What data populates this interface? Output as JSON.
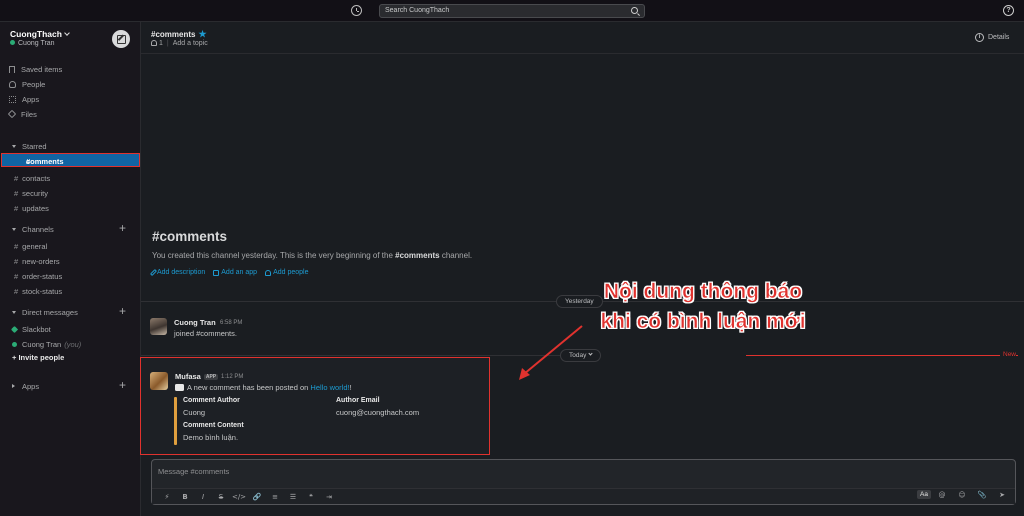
{
  "topbar": {
    "search_placeholder": "Search CuongThach",
    "help": "?"
  },
  "sidebar": {
    "workspace": "CuongThach",
    "user": "Cuong Tran",
    "nav": [
      {
        "label": "Saved items",
        "icon": "bookmark-icon"
      },
      {
        "label": "People",
        "icon": "people-icon"
      },
      {
        "label": "Apps",
        "icon": "apps-icon"
      },
      {
        "label": "Files",
        "icon": "files-icon"
      }
    ],
    "starred": {
      "title": "Starred",
      "active": "comments",
      "items": [
        "contacts",
        "security",
        "updates"
      ]
    },
    "channels": {
      "title": "Channels",
      "items": [
        "general",
        "new-orders",
        "order-status",
        "stock-status"
      ]
    },
    "dms": {
      "title": "Direct messages",
      "items": [
        {
          "name": "Slackbot",
          "suffix": ""
        },
        {
          "name": "Cuong Tran",
          "suffix": "(you)"
        }
      ],
      "invite": "Invite people"
    },
    "apps_title": "Apps",
    "hash": "#"
  },
  "channel": {
    "name": "#comments",
    "members": "1",
    "add_topic": "Add a topic",
    "details": "Details",
    "intro_title": "#comments",
    "intro_text_pre": "You created this channel yesterday. This is the very beginning of the ",
    "intro_text_channel": "#comments",
    "intro_text_post": " channel.",
    "links": [
      "Add description",
      "Add an app",
      "Add people"
    ]
  },
  "dividers": {
    "yesterday": "Yesterday",
    "today": "Today",
    "new": "New"
  },
  "messages": {
    "join": {
      "author": "Cuong Tran",
      "time": "6:58 PM",
      "text": "joined #comments."
    },
    "bot": {
      "author": "Mufasa",
      "badge": "APP",
      "time": "1:12 PM",
      "text_pre": "A new comment has been posted on ",
      "link": "Hello world!",
      "text_post": "!",
      "fields": {
        "author_label": "Comment Author",
        "author_value": "Cuong",
        "email_label": "Author Email",
        "email_value": "cuong@cuongthach.com",
        "content_label": "Comment Content",
        "content_value": "Demo bình luận."
      }
    }
  },
  "composer": {
    "placeholder": "Message #comments",
    "tools": [
      "⚡",
      "B",
      "I",
      "S",
      "</>",
      "🔗",
      "≡",
      "☰",
      "❝",
      "⇥"
    ],
    "aa": "Aa",
    "right_tools": [
      "@",
      "☺",
      "📎",
      "➤"
    ]
  },
  "annotation": {
    "line1": "Nội dung thông báo",
    "line2": "khi có bình luận mới",
    "color": "#e0322e"
  }
}
